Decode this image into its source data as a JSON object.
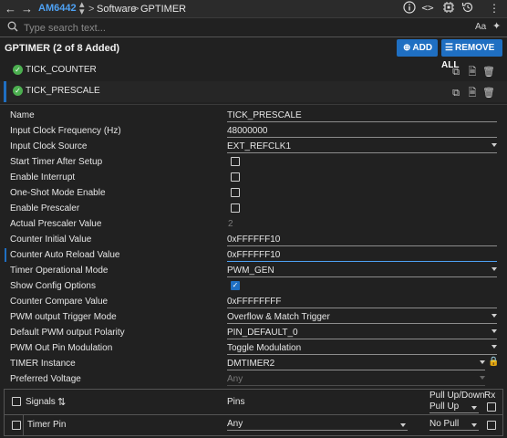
{
  "topbar": {
    "device": "AM6442",
    "crumb_software": "Software",
    "crumb_sep": ">",
    "crumb_module": "GPTIMER"
  },
  "search": {
    "placeholder": "Type search text...",
    "case_label": "Aa"
  },
  "header": {
    "title": "GPTIMER (2 of 8 Added)",
    "add_label": "ADD",
    "remove_all_label": "REMOVE ALL",
    "accent": "#1f6fc2"
  },
  "instances": [
    {
      "label": "TICK_COUNTER",
      "selected": false
    },
    {
      "label": "TICK_PRESCALE",
      "selected": true
    }
  ],
  "properties": [
    {
      "label": "Name",
      "value": "TICK_PRESCALE",
      "kind": "text"
    },
    {
      "label": "Input Clock Frequency (Hz)",
      "value": "48000000",
      "kind": "text"
    },
    {
      "label": "Input Clock Source",
      "value": "EXT_REFCLK1",
      "kind": "select"
    },
    {
      "label": "Start Timer After Setup",
      "checked": false,
      "kind": "checkbox"
    },
    {
      "label": "Enable Interrupt",
      "checked": false,
      "kind": "checkbox"
    },
    {
      "label": "One-Shot Mode Enable",
      "checked": false,
      "kind": "checkbox"
    },
    {
      "label": "Enable Prescaler",
      "checked": false,
      "kind": "checkbox"
    },
    {
      "label": "Actual Prescaler Value",
      "value": "2",
      "kind": "readonly"
    },
    {
      "label": "Counter Initial Value",
      "value": "0xFFFFFF10",
      "kind": "text"
    },
    {
      "label": "Counter Auto Reload Value",
      "value": "0xFFFFFF10",
      "kind": "text-active"
    },
    {
      "label": "Timer Operational Mode",
      "value": "PWM_GEN",
      "kind": "select"
    },
    {
      "label": "Show Config Options",
      "checked": true,
      "kind": "checkbox"
    },
    {
      "label": "Counter Compare Value",
      "value": "0xFFFFFFFF",
      "kind": "text"
    },
    {
      "label": "PWM output Trigger Mode",
      "value": "Overflow & Match Trigger",
      "kind": "select"
    },
    {
      "label": "Default PWM output Polarity",
      "value": "PIN_DEFAULT_0",
      "kind": "select"
    },
    {
      "label": "PWM Out Pin Modulation",
      "value": "Toggle Modulation",
      "kind": "select"
    },
    {
      "label": "TIMER Instance",
      "value": "DMTIMER2",
      "kind": "select-locked"
    },
    {
      "label": "Preferred Voltage",
      "value": "Any",
      "kind": "select-disabled"
    }
  ],
  "pins": {
    "col_signals": "Signals",
    "col_pins": "Pins",
    "col_pull": "Pull Up/Down",
    "col_rx": "Rx",
    "header_pull_value": "Pull Up",
    "rows": [
      {
        "signal": "Timer Pin",
        "pin": "Any",
        "pull": "No Pull"
      }
    ]
  }
}
